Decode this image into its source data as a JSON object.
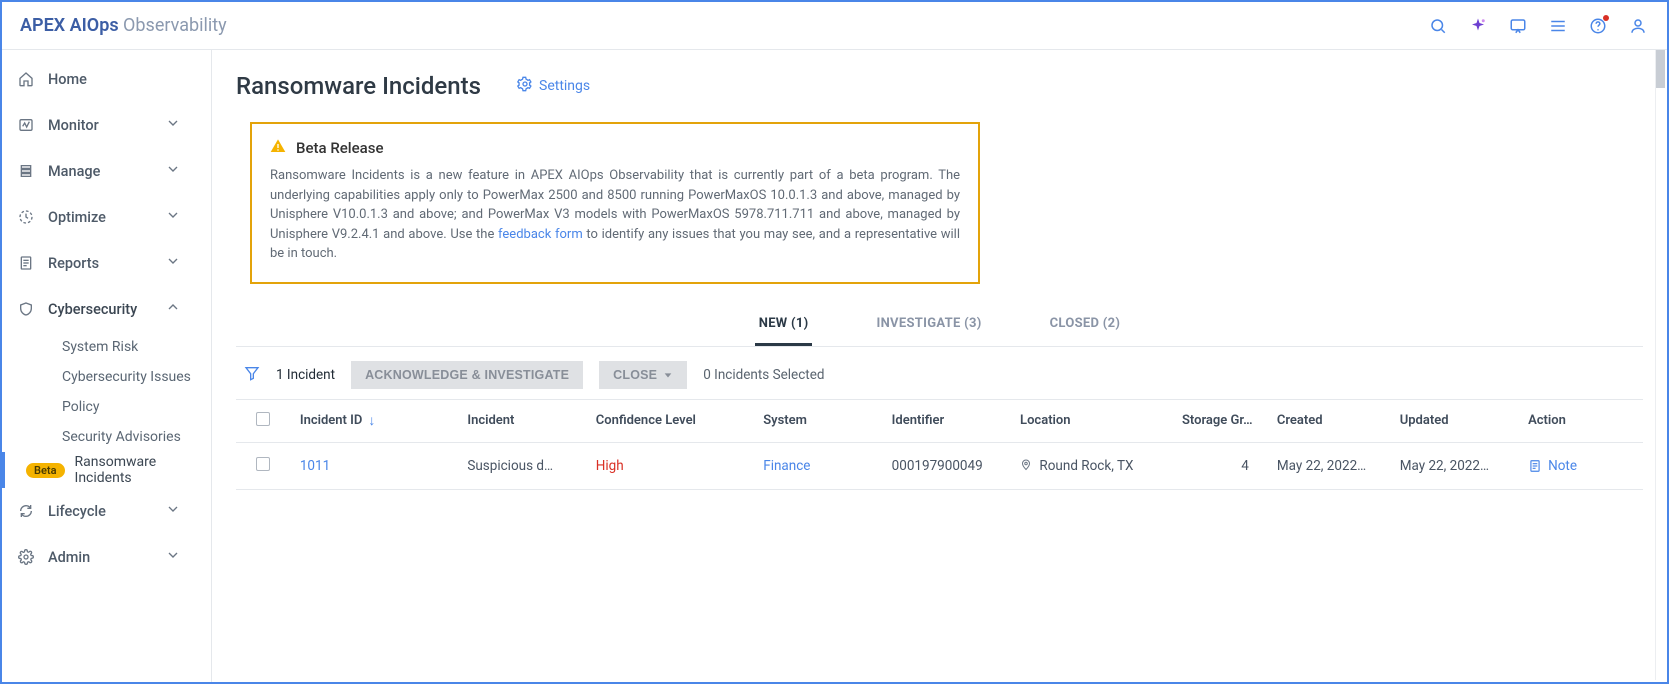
{
  "brand": {
    "strong": "APEX AIOps",
    "sub": "Observability"
  },
  "topbar_icons": [
    "search-icon",
    "sparkle-icon",
    "chat-icon",
    "stack-icon",
    "help-icon",
    "user-icon"
  ],
  "sidebar": {
    "items": [
      {
        "label": "Home"
      },
      {
        "label": "Monitor"
      },
      {
        "label": "Manage"
      },
      {
        "label": "Optimize"
      },
      {
        "label": "Reports"
      },
      {
        "label": "Cybersecurity"
      },
      {
        "label": "Lifecycle"
      },
      {
        "label": "Admin"
      }
    ],
    "cyber_children": [
      {
        "label": "System Risk"
      },
      {
        "label": "Cybersecurity Issues"
      },
      {
        "label": "Policy"
      },
      {
        "label": "Security Advisories"
      },
      {
        "badge": "Beta",
        "label": "Ransomware Incidents"
      }
    ]
  },
  "page": {
    "title": "Ransomware Incidents",
    "settings_label": "Settings"
  },
  "beta": {
    "heading": "Beta Release",
    "text_before_link": "Ransomware Incidents is a new feature in APEX AIOps Observability that is currently part of a beta program. The underlying capabilities apply only to PowerMax 2500 and 8500 running PowerMaxOS 10.0.1.3 and above, managed by Unisphere V10.0.1.3 and above; and PowerMax V3 models with PowerMaxOS 5978.711.711 and above, managed by Unisphere V9.2.4.1 and above. Use the ",
    "link_text": "feedback form",
    "text_after_link": " to identify any issues that you may see, and a representative will be in touch."
  },
  "tabs": [
    {
      "label": "NEW (1)",
      "active": true
    },
    {
      "label": "INVESTIGATE (3)"
    },
    {
      "label": "CLOSED (2)"
    }
  ],
  "actions": {
    "count_label": "1 Incident",
    "ack_button": "ACKNOWLEDGE & INVESTIGATE",
    "close_button": "CLOSE",
    "selected_label": "0 Incidents Selected"
  },
  "table": {
    "headers": {
      "id": "Incident ID",
      "incident": "Incident",
      "confidence": "Confidence Level",
      "system": "System",
      "identifier": "Identifier",
      "location": "Location",
      "storage_groups": "Storage Gr…",
      "created": "Created",
      "updated": "Updated",
      "action": "Action"
    },
    "rows": [
      {
        "id": "1011",
        "incident": "Suspicious d…",
        "confidence": "High",
        "system": "Finance",
        "identifier": "000197900049",
        "location": "Round Rock, TX",
        "storage_groups": "4",
        "created": "May 22, 2022…",
        "updated": "May 22, 2022…",
        "action": "Note"
      }
    ]
  }
}
